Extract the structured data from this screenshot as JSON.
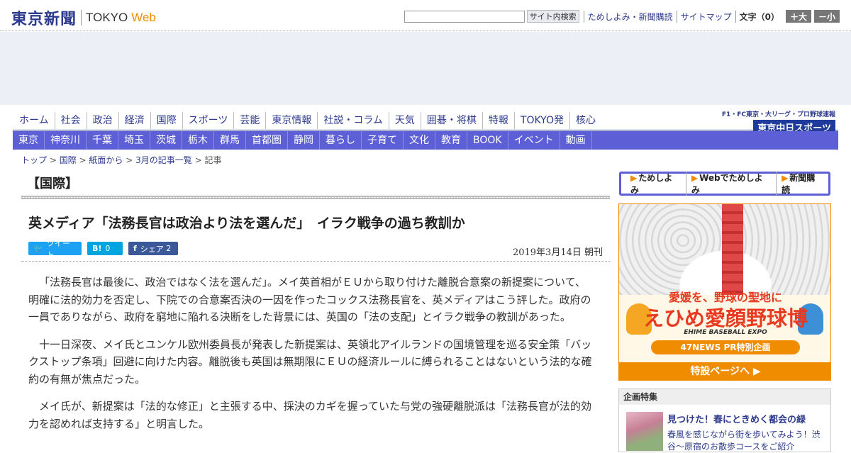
{
  "header": {
    "logo_jp": "東京新聞",
    "logo_en": "TOKYO",
    "logo_web": "Web",
    "search_button": "サイト内検索",
    "links": [
      "ためしよみ・新聞購読",
      "サイトマップ"
    ],
    "font_label": "文字（0）",
    "font_larger": "＋大",
    "font_smaller": "－小"
  },
  "nav_primary": [
    "ホーム",
    "社会",
    "政治",
    "経済",
    "国際",
    "スポーツ",
    "芸能",
    "東京情報",
    "社説・コラム",
    "天気",
    "囲碁・将棋",
    "特報",
    "TOKYO発",
    "核心"
  ],
  "chunichi": {
    "top": "F1・FC東京・大リーグ・プロ野球速報",
    "logo": "東京中日スポーツ"
  },
  "nav_secondary": [
    "東京",
    "神奈川",
    "千葉",
    "埼玉",
    "茨城",
    "栃木",
    "群馬",
    "首都圏",
    "静岡",
    "暮らし",
    "子育て",
    "文化",
    "教育",
    "BOOK",
    "イベント",
    "動画"
  ],
  "breadcrumb": {
    "items": [
      "トップ",
      "国際",
      "紙面から",
      "3月の記事一覧"
    ],
    "current": "記事"
  },
  "section_title": "【国際】",
  "article": {
    "headline": "英メディア「法務長官は政治より法を選んだ」　イラク戦争の過ち教訓か",
    "tweet_label": "ツイート",
    "hatena_label": "B!",
    "hatena_count": "0",
    "share_label": "シェア",
    "share_count": "2",
    "date": "2019年3月14日 朝刊",
    "paragraphs": [
      "「法務長官は最後に、政治ではなく法を選んだ」。メイ英首相がＥＵから取り付けた離脱合意案の新提案について、明確に法的効力を否定し、下院での合意案否決の一因を作ったコックス法務長官を、英メディアはこう評した。政府の一員でありながら、政府を窮地に陥れる決断をした背景には、英国の「法の支配」とイラク戦争の教訓があった。",
      "十一日深夜、メイ氏とユンケル欧州委員長が発表した新提案は、英領北アイルランドの国境管理を巡る安全策「バックストップ条項」回避に向けた内容。離脱後も英国は無期限にＥＵの経済ルールに縛られることはないという法的な確約の有無が焦点だった。",
      "メイ氏が、新提案は「法的な修正」と主張する中、採決のカギを握っていた与党の強硬離脱派は「法務長官が法的効力を認めれば支持する」と明言した。"
    ]
  },
  "sidebar": {
    "subscribe": [
      "ためしよみ",
      "Webでためしよみ",
      "新聞購読"
    ],
    "promo": {
      "sub": "愛媛を、野球の聖地に",
      "main": "えひめ愛顔野球博",
      "en": "EHIME BASEBALL EXPO",
      "band": "47NEWS PR特別企画",
      "cta": "特設ページへ ▶"
    },
    "feature": {
      "head": "企画特集",
      "title": "見つけた！春にときめく都会の緑",
      "text": "春風を感じながら街を歩いてみよう！渋谷～原宿のお散歩コースをご紹介"
    }
  }
}
